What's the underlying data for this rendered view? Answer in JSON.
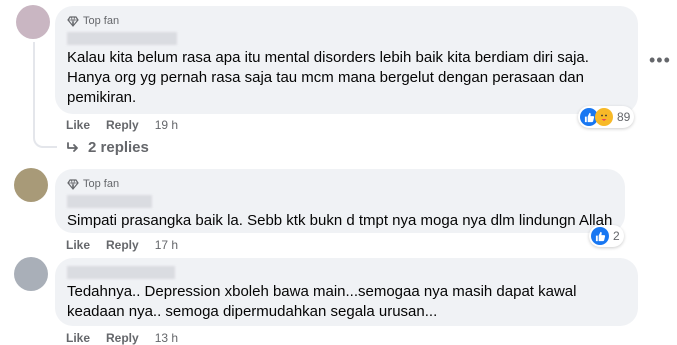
{
  "comments": [
    {
      "badge": "Top fan",
      "text": "Kalau kita belum rasa apa itu mental disorders lebih baik kita berdiam diri saja. Hanya org yg pernah rasa saja tau mcm mana bergelut dengan perasaan dan pemikiran.",
      "like": "Like",
      "reply": "Reply",
      "time": "19 h",
      "reaction_count": "89",
      "replies": "2 replies",
      "avatar_color": "#c9b6c2"
    },
    {
      "badge": "Top fan",
      "text": "Simpati prasangka baik la. Sebb ktk bukn d tmpt nya moga nya dlm lindungn Allah",
      "like": "Like",
      "reply": "Reply",
      "time": "17 h",
      "reaction_count": "2",
      "avatar_color": "#a89a78"
    },
    {
      "text": "Tedahnya.. Depression xboleh bawa main...semogaa nya masih dapat kawal keadaan nya.. semoga dipermudahkan segala urusan...",
      "like": "Like",
      "reply": "Reply",
      "time": "13 h",
      "avatar_color": "#a9afb8"
    }
  ],
  "more_icon": "more-options-icon",
  "colors": {
    "bubble": "#f0f2f5",
    "like_blue": "#1877f2",
    "muted": "#65676b"
  }
}
